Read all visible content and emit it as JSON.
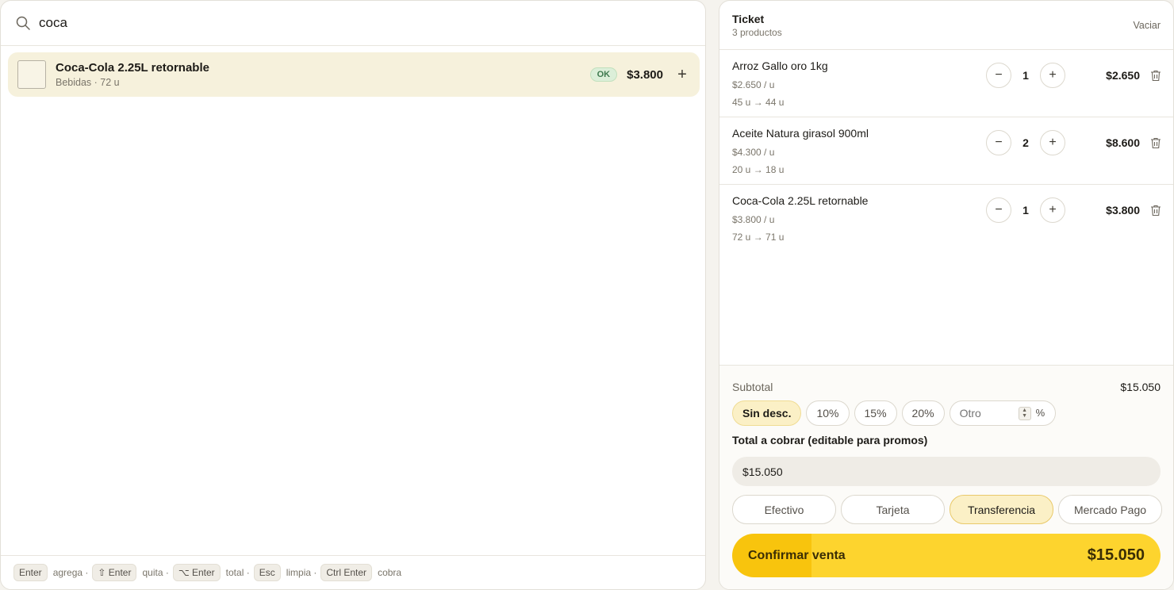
{
  "search": {
    "value": "coca"
  },
  "results": [
    {
      "name": "Coca-Cola 2.25L retornable",
      "category": "Bebidas",
      "stock": "72 u",
      "status": "OK",
      "price": "$3.800"
    }
  ],
  "shortcuts": [
    {
      "key": "Enter",
      "label": "agrega ·"
    },
    {
      "key": "⇧ Enter",
      "label": "quita ·"
    },
    {
      "key": "⌥ Enter",
      "label": "total ·"
    },
    {
      "key": "Esc",
      "label": "limpia ·"
    },
    {
      "key": "Ctrl Enter",
      "label": "cobra"
    }
  ],
  "ticket": {
    "title": "Ticket",
    "count": "3 productos",
    "clear_label": "Vaciar",
    "items": [
      {
        "name": "Arroz Gallo oro 1kg",
        "unit_price": "$2.650 / u",
        "stock": "45 u → 44 u",
        "qty": "1",
        "total": "$2.650"
      },
      {
        "name": "Aceite Natura girasol 900ml",
        "unit_price": "$4.300 / u",
        "stock": "20 u → 18 u",
        "qty": "2",
        "total": "$8.600"
      },
      {
        "name": "Coca-Cola 2.25L retornable",
        "unit_price": "$3.800 / u",
        "stock": "72 u → 71 u",
        "qty": "1",
        "total": "$3.800"
      }
    ],
    "subtotal_label": "Subtotal",
    "subtotal": "$15.050",
    "discounts": [
      "Sin desc.",
      "10%",
      "15%",
      "20%"
    ],
    "discount_other_placeholder": "Otro",
    "discount_pct": "%",
    "total_label": "Total a cobrar (editable para promos)",
    "total_value": "$15.050",
    "payments": [
      "Efectivo",
      "Tarjeta",
      "Transferencia",
      "Mercado Pago"
    ],
    "confirm_label": "Confirmar venta",
    "confirm_total": "$15.050"
  },
  "colors": {
    "accent": "#fdd42e",
    "accent_dark": "#f8c40d",
    "chip_active": "#fbf0c6",
    "ok_badge": "#dcefd9"
  }
}
